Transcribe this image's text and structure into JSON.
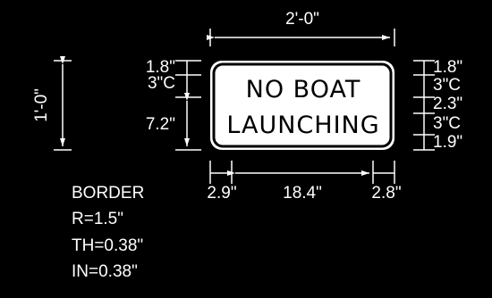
{
  "overall": {
    "width_label": "2'-0\"",
    "height_label": "1'-0\""
  },
  "sign": {
    "line1": "NO BOAT",
    "line2": "LAUNCHING",
    "background": "#ffffff",
    "text_color": "#000000"
  },
  "left_dims": {
    "top": "1.8\"",
    "second": "3\"C",
    "third": "7.2\""
  },
  "right_dims": {
    "a": "1.8\"",
    "b": "3\"C",
    "c": "2.3\"",
    "d": "3\"C",
    "e": "1.9\""
  },
  "bottom_dims": {
    "left": "2.9\"",
    "middle": "18.4\"",
    "right": "2.8\""
  },
  "border_notes": {
    "title": "BORDER",
    "radius": "R=1.5\"",
    "thickness": "TH=0.38\"",
    "inset": "IN=0.38\""
  },
  "colors": {
    "background": "#000000",
    "lines": "#ffffff"
  }
}
